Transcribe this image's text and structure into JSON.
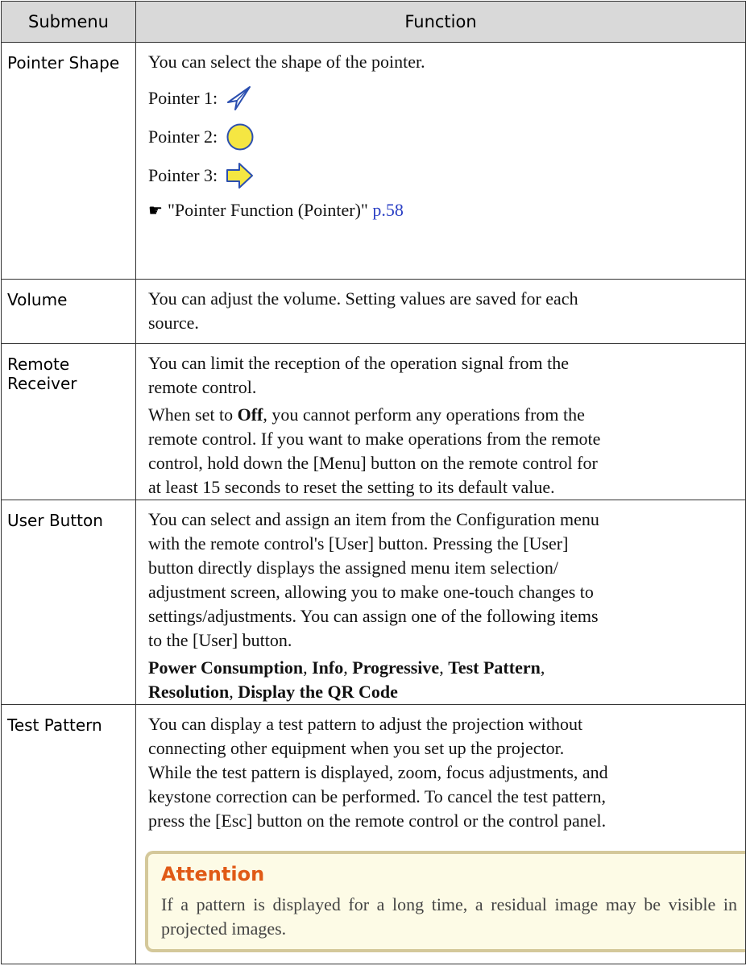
{
  "table": {
    "headers": {
      "submenu": "Submenu",
      "function": "Function"
    },
    "pointer_shape": {
      "name": "Pointer Shape",
      "desc": "You can select the shape of the pointer.",
      "pointer1": "Pointer 1:",
      "pointer2": "Pointer 2:",
      "pointer3": "Pointer 3:",
      "ref_text": "\"Pointer Function (Pointer)\"",
      "ref_page": "p.58"
    },
    "volume": {
      "name": "Volume",
      "line1": "You can adjust the volume. Setting values are saved for each",
      "line2": "source."
    },
    "remote_receiver": {
      "name": "Remote Receiver",
      "p1_line1": "You can limit the reception of the operation signal from the",
      "p1_line2": "remote control.",
      "p2_pre": "When set to ",
      "p2_bold": "Off",
      "p2_post": ", you cannot perform any operations from the",
      "p2_line2": "remote control. If you want to make operations from the remote",
      "p2_line3": "control, hold down the [Menu] button on the remote control for",
      "p2_line4": "at least 15 seconds to reset the setting to its default value."
    },
    "user_button": {
      "name": "User Button",
      "line1": "You can select and assign an item from the Configuration menu",
      "line2": "with the remote control's [User] button. Pressing the [User]",
      "line3": "button directly displays the assigned menu item selection/",
      "line4": "adjustment screen, allowing you to make one-touch changes to",
      "line5": "settings/adjustments. You can assign one of the following items",
      "line6": "to the [User] button.",
      "items1": "Power Consumption",
      "items2": "Info",
      "items3": "Progressive",
      "items4": "Test Pattern",
      "items5": "Resolution",
      "items6": "Display the QR Code"
    },
    "test_pattern": {
      "name": "Test Pattern",
      "line1": "You can display a test pattern to adjust the projection without",
      "line2": "connecting other equipment when you set up the projector.",
      "line3": "While the test pattern is displayed, zoom, focus adjustments, and",
      "line4": "keystone correction can be performed. To cancel the test pattern,",
      "line5": "press the [Esc] button on the remote control or the control panel.",
      "attention_title": "Attention",
      "attention_text": "If a pattern is displayed for a long time, a residual image may be visible in projected images."
    }
  },
  "icons": {
    "reference": "pointing-hand-icon"
  },
  "colors": {
    "link": "#2a3fc4",
    "attention_title": "#e05a16",
    "pointer_fill": "#f5e642",
    "pointer_stroke": "#2b4fb0"
  }
}
